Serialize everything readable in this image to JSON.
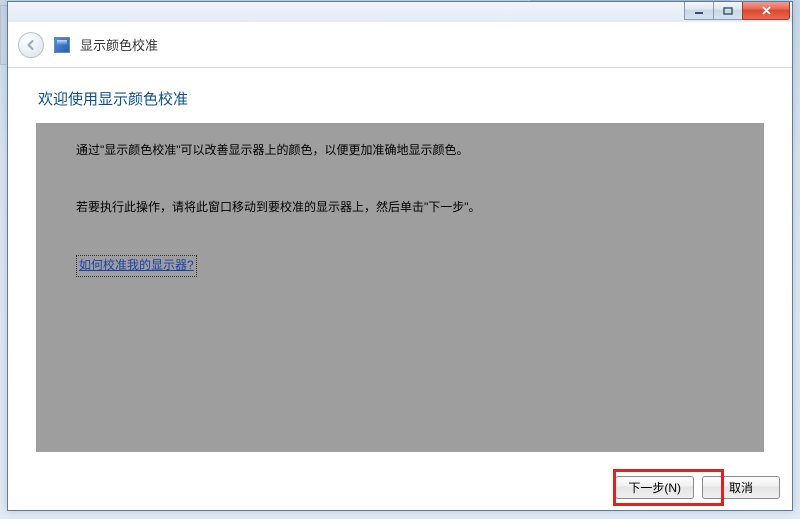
{
  "header": {
    "title": "显示颜色校准"
  },
  "content": {
    "heading": "欢迎使用显示颜色校准",
    "para1": "通过\"显示颜色校准\"可以改善显示器上的颜色，以便更加准确地显示颜色。",
    "para2": "若要执行此操作，请将此窗口移动到要校准的显示器上，然后单击\"下一步\"。",
    "help_link": "如何校准我的显示器?"
  },
  "footer": {
    "next": "下一步(N)",
    "cancel": "取消"
  }
}
